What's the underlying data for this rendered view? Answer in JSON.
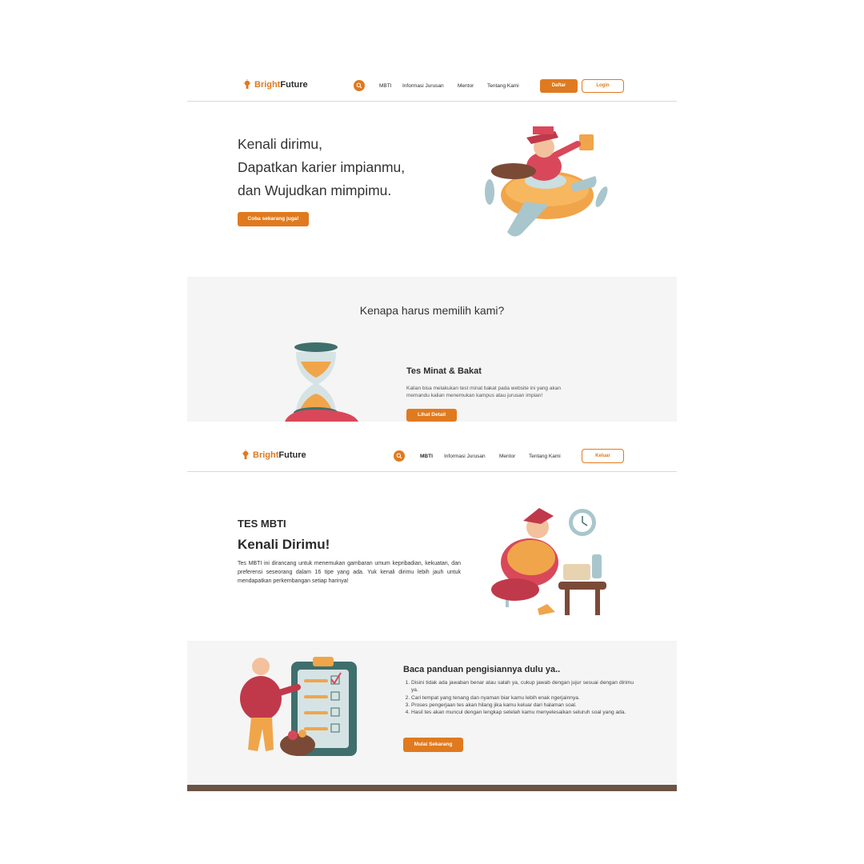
{
  "brand": {
    "name_part1": "Bright",
    "name_part2": "Future",
    "accent": "#e07a1f"
  },
  "screen1": {
    "nav": {
      "links": [
        "MBTI",
        "Informasi Jurusan",
        "Mentor",
        "Tentang Kami"
      ],
      "register_label": "Daftar",
      "login_label": "Login"
    },
    "hero": {
      "lines": [
        "Kenali dirimu,",
        "Dapatkan karier impianmu,",
        "dan Wujudkan mimpimu."
      ],
      "cta_label": "Coba sekarang juga!"
    },
    "why": {
      "title": "Kenapa harus memilih kami?",
      "feature_title": "Tes Minat & Bakat",
      "feature_desc": "Kalian bisa melakukan test minat bakat pada website ini yang akan memandu kalian menemukan kampus atau jurusan impian!",
      "feature_cta": "Lihat Detail"
    }
  },
  "screen2": {
    "nav": {
      "links": [
        "MBTI",
        "Informasi Jurusan",
        "Mentor",
        "Tentang Kami"
      ],
      "active": "MBTI",
      "logout_label": "Keluar"
    },
    "intro": {
      "label": "TES MBTI",
      "title": "Kenali Dirimu!",
      "description": "Tes MBTI ini dirancang untuk menemukan gambaran umum kepribadian, kekuatan, dan preferensi seseorang dalam 16 tipe yang ada. Yuk kenali dirimu lebih jauh untuk mendapatkan perkembangan setiap harinya!"
    },
    "guide": {
      "title": "Baca panduan pengisiannya dulu ya..",
      "items": [
        "Disini tidak ada jawaban benar atau salah ya, cukup jawab dengan jujur sesuai dengan dirimu ya.",
        "Cari tempat yang tenang dan nyaman biar kamu lebih enak ngerjainnya.",
        "Proses pengerjaan tes akan hilang jika kamu keluar dari halaman soal.",
        "Hasil tes akan muncul dengan lengkap setelah kamu menyelesaikan seluruh soal yang ada."
      ],
      "cta_label": "Mulai Sekarang"
    }
  }
}
